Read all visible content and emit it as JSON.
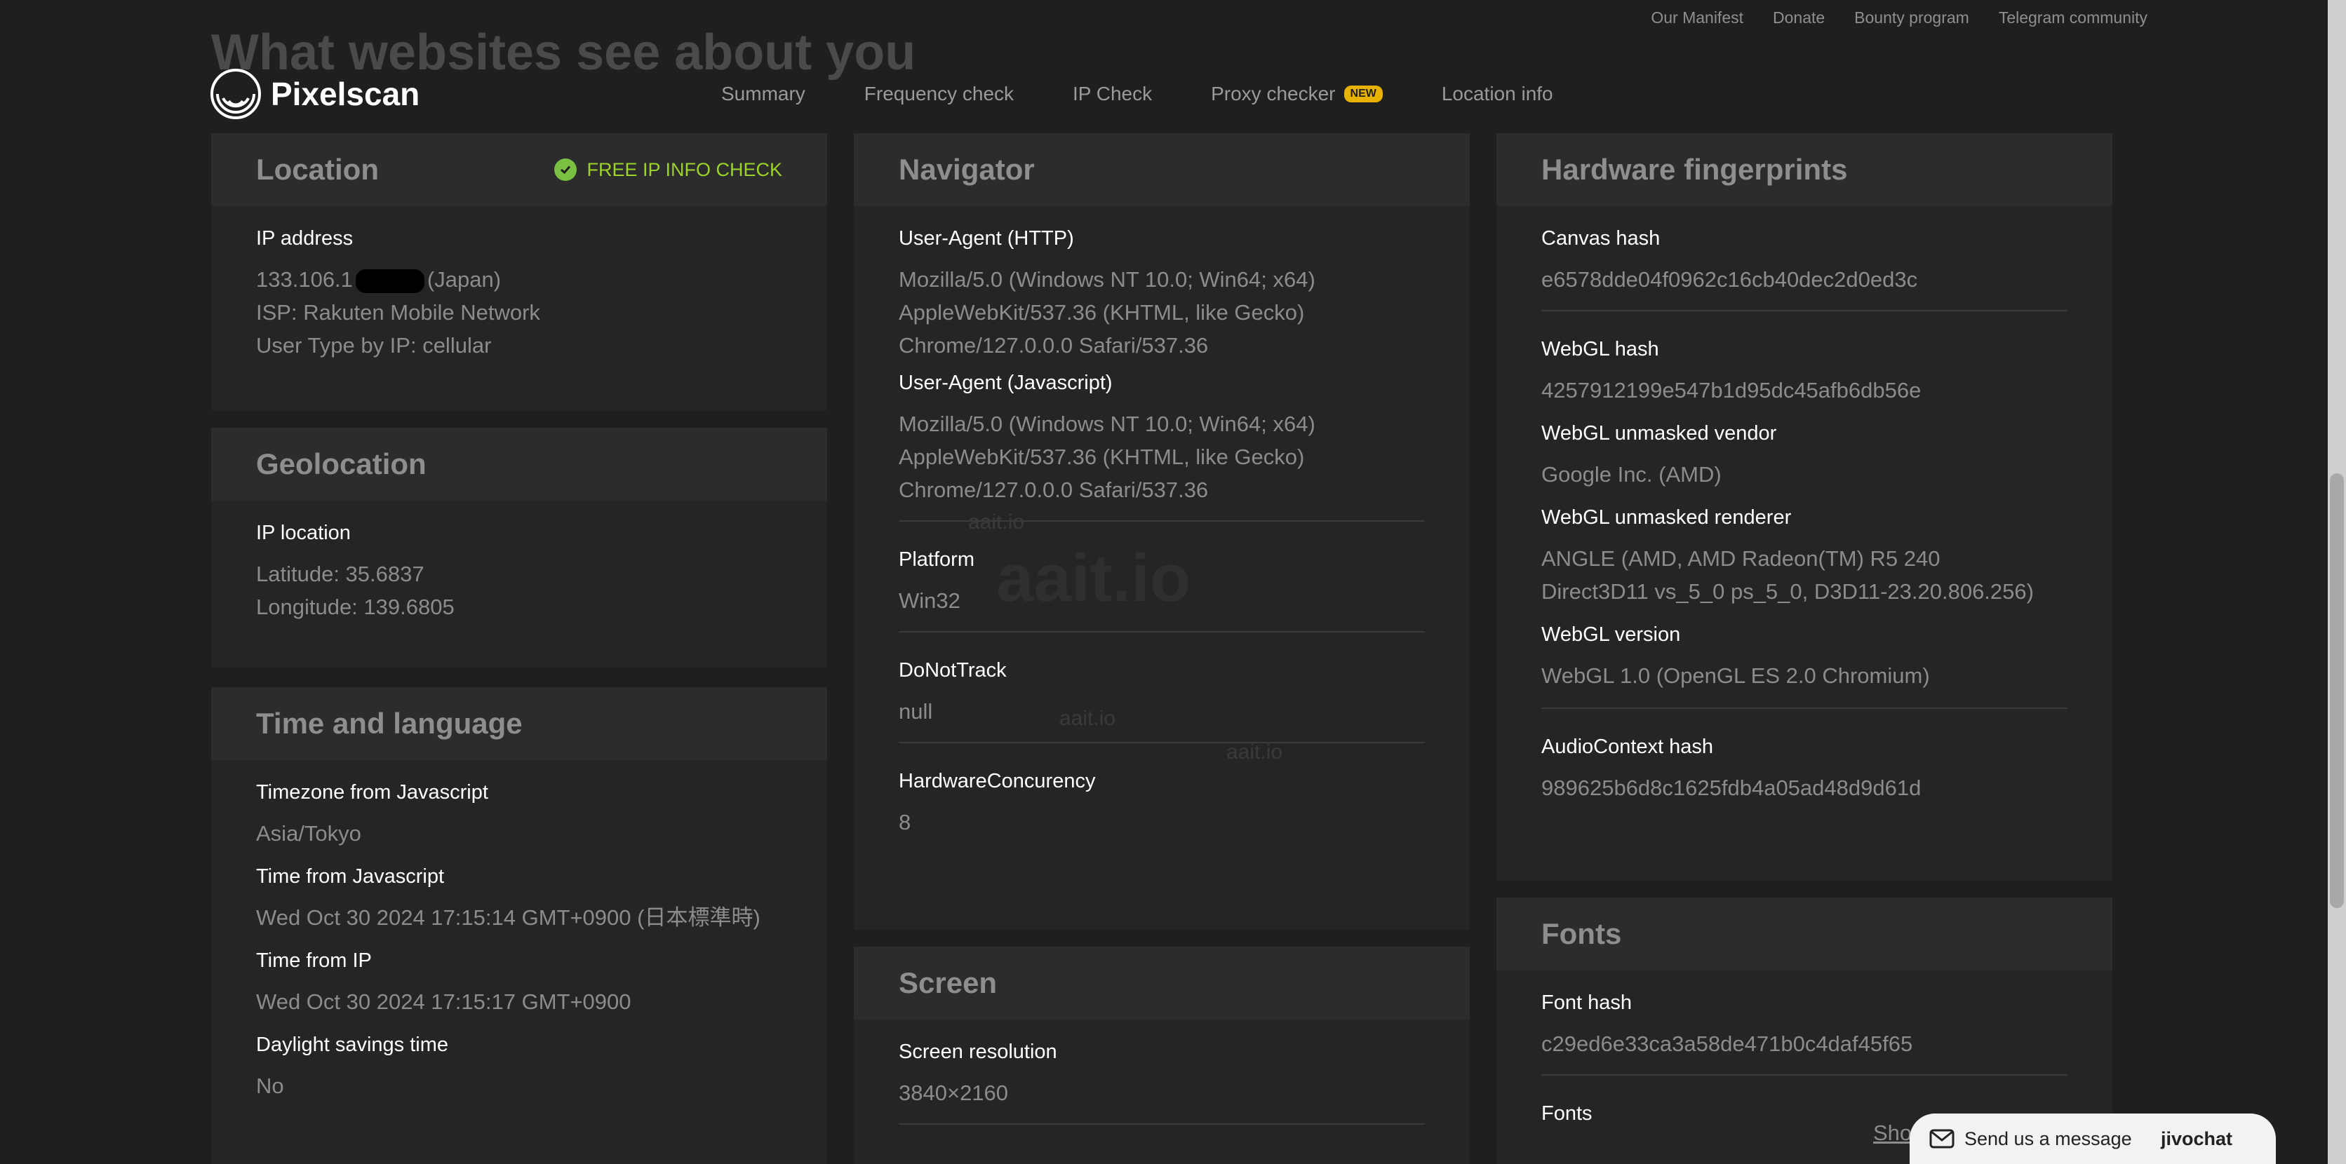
{
  "topbar": {
    "links": [
      "Our Manifest",
      "Donate",
      "Bounty program",
      "Telegram community"
    ]
  },
  "ghost_title": "What websites see about you",
  "brand": {
    "name": "Pixelscan"
  },
  "nav": {
    "items": [
      "Summary",
      "Frequency check",
      "IP Check",
      "Proxy checker",
      "Location info"
    ],
    "new_badge": "NEW"
  },
  "location": {
    "title": "Location",
    "free_check": "FREE IP INFO CHECK",
    "ip_label": "IP address",
    "ip_prefix": "133.106.1",
    "ip_suffix": "(Japan)",
    "isp": "ISP: Rakuten Mobile Network",
    "user_type": "User Type by IP: cellular"
  },
  "geolocation": {
    "title": "Geolocation",
    "ip_location_label": "IP location",
    "latitude": "Latitude: 35.6837",
    "longitude": "Longitude: 139.6805"
  },
  "time_language": {
    "title": "Time and language",
    "tz_label": "Timezone from Javascript",
    "tz_value": "Asia/Tokyo",
    "time_js_label": "Time from Javascript",
    "time_js_value": "Wed Oct 30 2024 17:15:14 GMT+0900 (日本標準時)",
    "time_ip_label": "Time from IP",
    "time_ip_value": "Wed Oct 30 2024 17:15:17 GMT+0900",
    "dst_label": "Daylight savings time",
    "dst_value": "No"
  },
  "navigator": {
    "title": "Navigator",
    "ua_http_label": "User-Agent (HTTP)",
    "ua_http_lines": [
      "Mozilla/5.0 (Windows NT 10.0; Win64; x64)",
      "AppleWebKit/537.36 (KHTML, like Gecko)",
      "Chrome/127.0.0.0 Safari/537.36"
    ],
    "ua_js_label": "User-Agent (Javascript)",
    "ua_js_lines": [
      "Mozilla/5.0 (Windows NT 10.0; Win64; x64)",
      "AppleWebKit/537.36 (KHTML, like Gecko)",
      "Chrome/127.0.0.0 Safari/537.36"
    ],
    "platform_label": "Platform",
    "platform_value": "Win32",
    "dnt_label": "DoNotTrack",
    "dnt_value": "null",
    "hc_label": "HardwareConcurency",
    "hc_value": "8"
  },
  "screen": {
    "title": "Screen",
    "res_label": "Screen resolution",
    "res_value": "3840×2160"
  },
  "hardware": {
    "title": "Hardware fingerprints",
    "canvas_label": "Canvas hash",
    "canvas_value": "e6578dde04f0962c16cb40dec2d0ed3c",
    "webgl_label": "WebGL hash",
    "webgl_value": "4257912199e547b1d95dc45afb6db56e",
    "vendor_label": "WebGL unmasked vendor",
    "vendor_value": "Google Inc. (AMD)",
    "renderer_label": "WebGL unmasked renderer",
    "renderer_lines": [
      "ANGLE (AMD, AMD Radeon(TM) R5 240",
      "Direct3D11 vs_5_0 ps_5_0, D3D11-23.20.806.256)"
    ],
    "version_label": "WebGL version",
    "version_value": "WebGL 1.0 (OpenGL ES 2.0 Chromium)",
    "audio_label": "AudioContext hash",
    "audio_value": "989625b6d8c1625fdb4a05ad48d9d61d"
  },
  "fonts": {
    "title": "Fonts",
    "hash_label": "Font hash",
    "hash_value": "c29ed6e33ca3a58de471b0c4daf45f65",
    "fonts_label": "Fonts",
    "show_link": "Sho"
  },
  "watermark": {
    "text": "aait.io"
  },
  "chat": {
    "label": "Send us a message",
    "brand": "jivochat"
  }
}
